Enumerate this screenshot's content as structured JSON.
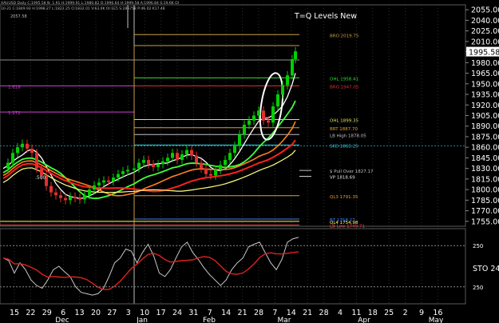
{
  "header": {
    "symbol": "XAUUSD Daily",
    "quote_line": "C:1995.58 N: 1.91 H:1999.91 L:1980.82 O:1996.64 H:1999.58 A:1996.84 S:19.6K OI",
    "sub_line": "10-21 C:1849.92 H:1998.27 L:1822.25 O:1832.01 V:63.0K OI:1E5 S:286758 P:46.02 K17.48",
    "corner_value": "2057.58"
  },
  "chart_data": [
    {
      "type": "line",
      "title": "T=Q Levels New",
      "price_tag": "1995.58",
      "y_ticks": [
        "2055.00",
        "2040.00",
        "2025.00",
        "2010.00",
        "1995.58",
        "1980.00",
        "1965.00",
        "1950.00",
        "1935.00",
        "1920.00",
        "1905.00",
        "1890.00",
        "1875.00",
        "1860.00",
        "1845.00",
        "1830.00",
        "1815.00",
        "1800.00",
        "1785.00",
        "1770.00",
        "1755.00"
      ],
      "ylim": [
        1748,
        2062
      ],
      "x_ticks": [
        "15",
        "22",
        "29",
        "6",
        "13",
        "20",
        "27",
        "3",
        "10",
        "17",
        "24",
        "31",
        "7",
        "14",
        "21",
        "28",
        "7",
        "14",
        "21",
        "28",
        "4",
        "11",
        "18",
        "25",
        "2",
        "9",
        "16"
      ],
      "month_labels": [
        "Dec",
        "Jan",
        "Feb",
        "Mar",
        "Apr",
        "May"
      ],
      "levels": [
        {
          "label": "BRO 2019.75",
          "value": 2019.75,
          "color": "#c8a040"
        },
        {
          "label": "OHL 1958.41",
          "value": 1958.41,
          "color": "#30e030"
        },
        {
          "label": "BRO 1947.05",
          "value": 1947.05,
          "color": "#e03030"
        },
        {
          "label": "1.618",
          "value": 1947.05,
          "color": "#d040d0"
        },
        {
          "label": "1.272",
          "value": 1910.0,
          "color": "#d040d0"
        },
        {
          "label": "OHL 1899.35",
          "value": 1899.35,
          "color": "#e0e060"
        },
        {
          "label": "BRT 1887.70",
          "value": 1887.7,
          "color": "#e0a030"
        },
        {
          "label": "LB High 1878.05",
          "value": 1878.05,
          "color": "#c0c0c0"
        },
        {
          "label": "SKO 1863.25",
          "value": 1863.25,
          "color": "#30d0e0"
        },
        {
          "label": "$ Pull Over 1827.17",
          "value": 1827.17,
          "color": "#c0c0c0"
        },
        {
          "label": "VP 1818.69",
          "value": 1818.69,
          "color": "#e0e0e0"
        },
        {
          "label": "QL3 1791.35",
          "value": 1791.35,
          "color": "#e0a030"
        },
        {
          "label": "QL4 1754.98",
          "value": 1754.98,
          "color": "#ffff60"
        },
        {
          "label": "BT 1758.27",
          "value": 1758.27,
          "color": "#4080ff"
        },
        {
          "label": "LB Low 1749.71",
          "value": 1749.71,
          "color": "#ff4040"
        }
      ],
      "side_labels": [
        "1.618",
        "1.272",
        ".500"
      ]
    },
    {
      "type": "line",
      "title": "STO",
      "value_label": "STO 24",
      "y_ticks": [
        "250",
        "250"
      ],
      "ylim": [
        0,
        100
      ]
    }
  ],
  "colors": {
    "up": "#00d000",
    "down": "#e03030",
    "grid": "#4a4a4a",
    "text": "#ffffff"
  }
}
